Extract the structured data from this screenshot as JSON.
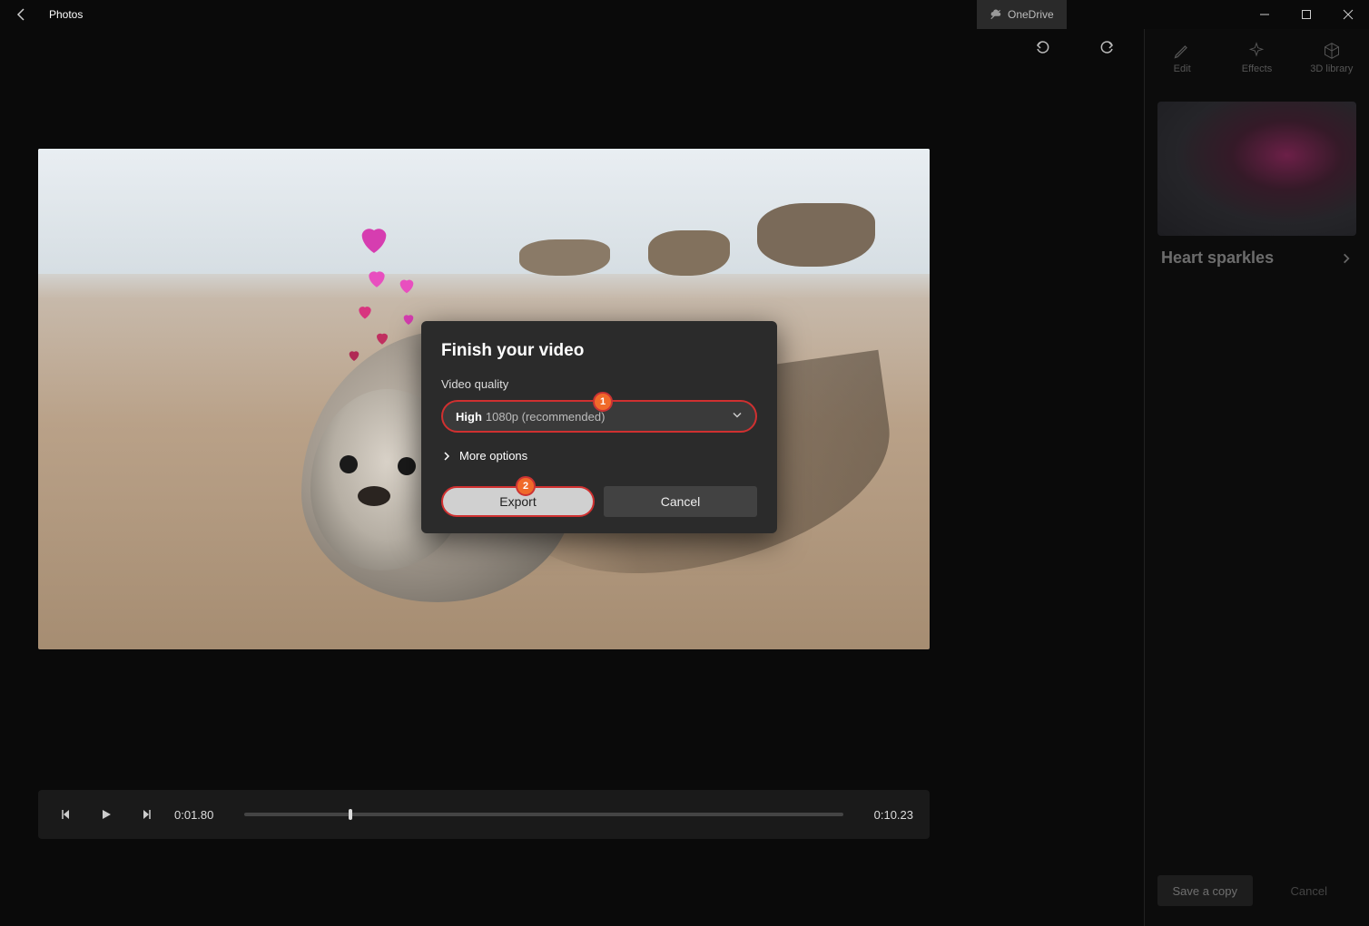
{
  "app": {
    "title": "Photos"
  },
  "onedrive": {
    "label": "OneDrive"
  },
  "sidebar": {
    "tabs": [
      {
        "label": "Edit"
      },
      {
        "label": "Effects"
      },
      {
        "label": "3D library"
      }
    ],
    "effect_name": "Heart sparkles",
    "save_copy": "Save a copy",
    "cancel": "Cancel"
  },
  "playback": {
    "current_time": "0:01.80",
    "total_time": "0:10.23"
  },
  "dialog": {
    "title": "Finish your video",
    "quality_label": "Video quality",
    "quality_value_strong": "High",
    "quality_value_muted": "1080p (recommended)",
    "more_options": "More options",
    "export": "Export",
    "cancel": "Cancel",
    "badge1": "1",
    "badge2": "2"
  }
}
